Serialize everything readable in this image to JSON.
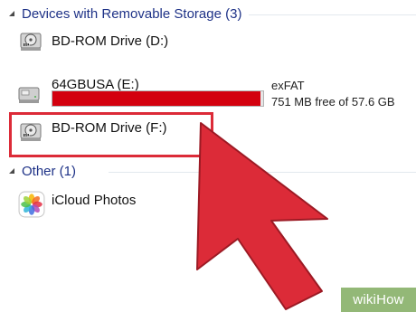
{
  "groups": {
    "removable": {
      "header": "Devices with Removable Storage (3)"
    },
    "other": {
      "header": "Other (1)"
    }
  },
  "drives": [
    {
      "label": "BD-ROM Drive (D:)",
      "icon": "bd-rom-drive-icon"
    },
    {
      "label": "64GBUSA (E:)",
      "icon": "usb-drive-icon",
      "filesystem": "exFAT",
      "free": "751 MB free of 57.6 GB",
      "used_fraction": 0.987
    },
    {
      "label": "BD-ROM Drive (F:)",
      "icon": "bd-rom-drive-icon"
    }
  ],
  "other_items": [
    {
      "label": "iCloud Photos",
      "icon": "icloud-photos-icon"
    }
  ],
  "colors": {
    "header": "#1e3287",
    "usage_bar": "#d3000e",
    "highlight": "#dc2b38",
    "pointer_arrow": "#dc2b38",
    "watermark_bg": "#93b877"
  },
  "watermark": "wikiHow"
}
